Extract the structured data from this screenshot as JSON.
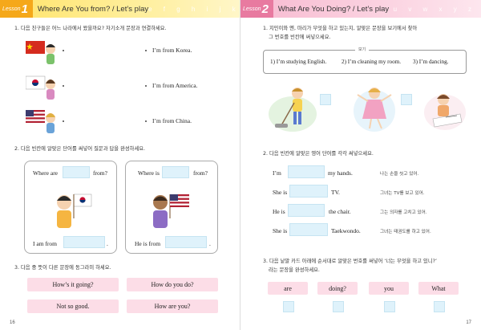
{
  "left": {
    "lesson_small": "Lesson",
    "lesson_num": "1",
    "title": "Where Are You from? / Let’s play",
    "deco": "e f g h i j k l",
    "q1": "1. 다음 친구들은 어느 나라에서 왔을까요? 자기소개 문장과 연결하세요.",
    "q1_answers": [
      "I’m from Korea.",
      "I’m from America.",
      "I’m from China."
    ],
    "q2": "2. 다음 빈칸에 알맞은 단어를 써넣어 질문과 답을 완성하세요.",
    "card1_q_pre": "Where are",
    "card1_q_post": "from?",
    "card1_a_pre": "I am from",
    "card1_a_post": ".",
    "card2_q_pre": "Where is",
    "card2_q_post": "from?",
    "card2_a_pre": "He is from",
    "card2_a_post": ".",
    "q3": "3. 다음 중 뜻이 다른 문장에 동그라미 하세요.",
    "phrases": [
      "How’s it going?",
      "How do you do?",
      "Not so good.",
      "How are you?"
    ],
    "page_number": "16"
  },
  "right": {
    "lesson_small": "Lesson",
    "lesson_num": "2",
    "title": "What Are You Doing? / Let’s play",
    "deco": "u v w x y z",
    "q1_line1": "1. 지민이와 엔, 마리가 무엇을 하고 있는지, 알맞은 문장을 보기에서 찾아",
    "q1_line2": "그 번호를 빈칸에 써넣으세요.",
    "example_label": "보기",
    "example_items": [
      "1) I’m studying English.",
      "2) I’m cleaning my room.",
      "3) I’m dancing."
    ],
    "q2": "2. 다음 빈칸에 알맞은 영어 단어를 각각 써넣으세요.",
    "fill_rows": [
      {
        "pre": "I’m",
        "post": "my hands.",
        "korean": "나는 손을 씻고 있어."
      },
      {
        "pre": "She is",
        "post": "TV.",
        "korean": "그녀는 TV를 보고 있어."
      },
      {
        "pre": "He is",
        "post": "the chair.",
        "korean": "그는 의자를 고치고 있어."
      },
      {
        "pre": "She is",
        "post": "Taekwondo.",
        "korean": "그녀는 태권도를 하고 있어."
      }
    ],
    "q3_line1": "3. 다음 낱말 카드 아래에 순서대로 알맞은 번호를 써넣어 ‘너는 무엇을 하고 있니?’",
    "q3_line2": "라는 문장을 완성하세요.",
    "word_cards": [
      "are",
      "doing?",
      "you",
      "What"
    ],
    "page_number": "17"
  },
  "colors": {
    "left_header": "#ffe46b",
    "left_badge": "#f5a81a",
    "right_header": "#f7b9d0",
    "right_badge": "#e87aa0",
    "blank": "#dff2fb",
    "pill": "#fcdde7"
  }
}
